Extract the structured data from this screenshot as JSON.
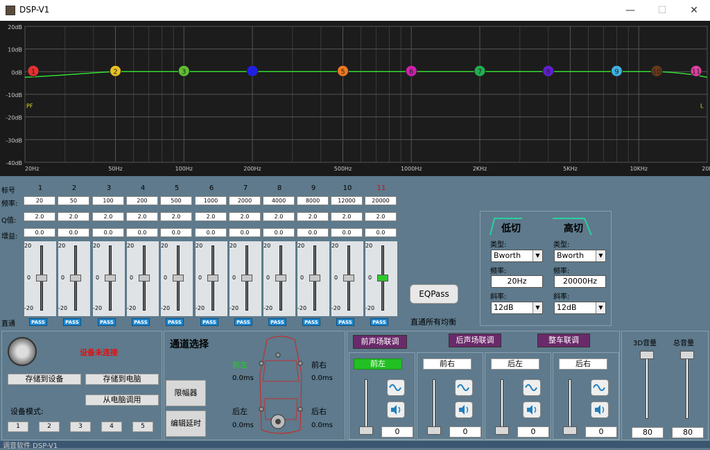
{
  "window": {
    "title": "DSP-V1",
    "min": "—",
    "max": "☐",
    "close": "✕"
  },
  "graph": {
    "db_labels": [
      "20dB",
      "10dB",
      "0dB",
      "-10dB",
      "-20dB",
      "-30dB",
      "-40dB"
    ],
    "freq_labels": [
      "20Hz",
      "50Hz",
      "100Hz",
      "200Hz",
      "500Hz",
      "1000Hz",
      "2KHz",
      "5KHz",
      "10KHz",
      "20K"
    ],
    "markers": [
      "1",
      "2",
      "3",
      "",
      "5",
      "6",
      "7",
      "8",
      "9",
      "10",
      "11"
    ],
    "hpf_label": "PF",
    "lpf_label": "L"
  },
  "eq": {
    "row_labels": {
      "band": "标号",
      "freq": "频率:",
      "q": "Q值:",
      "gain": "增益:",
      "direct": "直通"
    },
    "bands": [
      "1",
      "2",
      "3",
      "4",
      "5",
      "6",
      "7",
      "8",
      "9",
      "10",
      "11"
    ],
    "freqs": [
      "20",
      "50",
      "100",
      "200",
      "500",
      "1000",
      "2000",
      "4000",
      "8000",
      "12000",
      "20000"
    ],
    "qs": [
      "2.0",
      "2.0",
      "2.0",
      "2.0",
      "2.0",
      "2.0",
      "2.0",
      "2.0",
      "2.0",
      "2.0",
      "2.0"
    ],
    "gains": [
      "0.0",
      "0.0",
      "0.0",
      "0.0",
      "0.0",
      "0.0",
      "0.0",
      "0.0",
      "0.0",
      "0.0",
      "0.0"
    ],
    "slider_ticks": [
      "20",
      "0",
      "-20"
    ],
    "pass": "PASS",
    "eqpass": "EQPass",
    "direct_all": "直通所有均衡"
  },
  "filters": {
    "low": {
      "title": "低切",
      "type_label": "类型:",
      "type": "Bworth",
      "freq_label": "频率:",
      "freq": "20Hz",
      "slope_label": "斜率:",
      "slope": "12dB"
    },
    "high": {
      "title": "高切",
      "type_label": "类型:",
      "type": "Bworth",
      "freq_label": "频率:",
      "freq": "20000Hz",
      "slope_label": "斜率:",
      "slope": "12dB"
    }
  },
  "device": {
    "status": "设备未连接",
    "save_device": "存储到设备",
    "save_pc": "存储到电脑",
    "load_pc": "从电脑调用",
    "mode_label": "设备模式:",
    "modes": [
      "1",
      "2",
      "3",
      "4",
      "5"
    ]
  },
  "channel": {
    "title": "通道选择",
    "limiter": "限幅器",
    "edit_delay": "编辑延时",
    "fl": "前左",
    "fr": "前右",
    "rl": "后左",
    "rr": "后右",
    "fl_delay": "0.0ms",
    "fr_delay": "0.0ms",
    "rl_delay": "0.0ms",
    "rr_delay": "0.0ms"
  },
  "mixer": {
    "front_link": "前声场联调",
    "rear_link": "后声场联调",
    "car_link": "整车联调",
    "channels": [
      {
        "name": "前左",
        "value": "0"
      },
      {
        "name": "前右",
        "value": "0"
      },
      {
        "name": "后左",
        "value": "0"
      },
      {
        "name": "后右",
        "value": "0"
      }
    ],
    "vol3d_label": "3D音量",
    "vol3d": "80",
    "master_label": "总音量",
    "master": "80"
  },
  "colors": {
    "curve": "#33dd33",
    "marker1": "#e53030",
    "marker2": "#e8c020",
    "marker3": "#5fbf30",
    "marker4": "#2020e0",
    "marker5": "#f07820",
    "marker6": "#d020b0",
    "marker7": "#20b050",
    "marker8": "#6020d0",
    "marker9": "#40b0e0",
    "marker10": "#6a3a1a",
    "marker11": "#e040a0"
  },
  "taskbar": {
    "text": "调音软件 DSP-V1"
  }
}
